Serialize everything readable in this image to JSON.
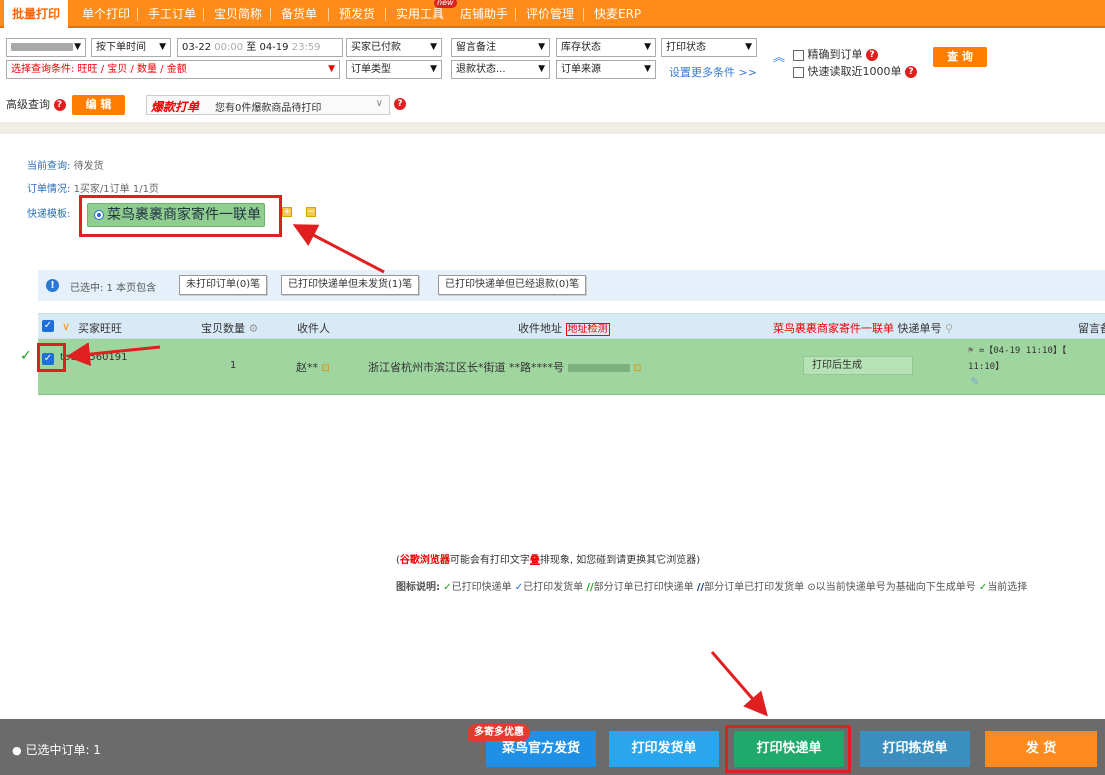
{
  "nav": {
    "tabs": [
      {
        "label": "批量打印",
        "active": true
      },
      {
        "label": "单个打印"
      },
      {
        "label": "手工订单"
      },
      {
        "label": "宝贝简称"
      },
      {
        "label": "备货单"
      },
      {
        "label": "预发货"
      },
      {
        "label": "实用工具",
        "badge": "new"
      },
      {
        "label": "店铺助手"
      },
      {
        "label": "评价管理"
      },
      {
        "label": "快麦ERP"
      }
    ]
  },
  "filters": {
    "time_type": "按下单时间",
    "date_start": "03-22",
    "time_start": "00:00",
    "date_sep": "至",
    "date_end": "04-19",
    "time_end": "23:59",
    "pay_status": "买家已付款",
    "remark": "留言备注",
    "stock_status": "库存状态",
    "print_status": "打印状态",
    "query_condition": "选择查询条件: 旺旺 / 宝贝 / 数量 / 金额",
    "order_type": "订单类型",
    "refund_status": "退款状态...",
    "order_source": "订单来源",
    "more_conditions": "设置更多条件 >>",
    "exact_order": "精确到订单",
    "quick_read": "快速读取近1000单",
    "query_btn": "查 询",
    "advanced_query": "高级查询",
    "edit_btn": "编 辑",
    "hot_print_label": "爆款打单",
    "hot_print_value": "您有0件爆款商品待打印"
  },
  "summary": {
    "current_query_label": "当前查询:",
    "current_query_value": "待发货",
    "order_status_label": "订单情况:",
    "order_status_value": "1买家/1订单  1/1页",
    "template_label": "快递模板:",
    "template_name": "菜鸟裹裹商家寄件一联单"
  },
  "selection_bar": {
    "selected_text": "已选中: 1  本页包含",
    "btn_unprinted": "未打印订单(0)笔",
    "btn_printed_unshipped": "已打印快递单但未发货(1)笔",
    "btn_printed_refunded": "已打印快递单但已经退款(0)笔"
  },
  "table": {
    "headers": {
      "buyer": "买家旺旺",
      "qty": "宝贝数量",
      "receiver": "收件人",
      "address": "收件地址",
      "address_check": "地址检测",
      "waybill_tpl": "菜鸟裹裹商家寄件一联单",
      "waybill_no": "快递单号",
      "remark": "留言备"
    },
    "rows": [
      {
        "buyer": "tb112560191",
        "qty": "1",
        "receiver": "赵**",
        "address": "浙江省杭州市滨江区长*街道 **路****号",
        "waybill": "打印后生成",
        "remark_line1": "=【04-19 11:10】【",
        "remark_line2": "11:10】"
      }
    ]
  },
  "notes": {
    "browser_warning_prefix": "(",
    "browser_warning_name": "谷歌浏览器",
    "browser_warning_mid": "可能会有打印文字",
    "browser_warning_key": "叠",
    "browser_warning_suffix": "排现象, 如您碰到请更换其它浏览器)",
    "legend_label": "图标说明:",
    "legend_1": "已打印快递单",
    "legend_2": "已打印发货单",
    "legend_3": "部分订单已打印快递单",
    "legend_4": "部分订单已打印发货单",
    "legend_5": "以当前快递单号为基础向下生成单号",
    "legend_6": "当前选择"
  },
  "bottom": {
    "selected_orders": "已选中订单: 1",
    "promo": "多寄多优惠",
    "btn_cainiao": "菜鸟官方发货",
    "btn_print_invoice": "打印发货单",
    "btn_print_waybill": "打印快递单",
    "btn_print_pick": "打印拣货单",
    "btn_ship": "发 货"
  },
  "colors": {
    "nav_orange": "#ff8c1a",
    "row_green": "#9fd59f",
    "btn_blue": "#1f90e6",
    "btn_green": "#1fa96a",
    "btn_steel": "#3b8fbf",
    "btn_orange": "#ff8a1f",
    "annotation_red": "#e02020"
  }
}
